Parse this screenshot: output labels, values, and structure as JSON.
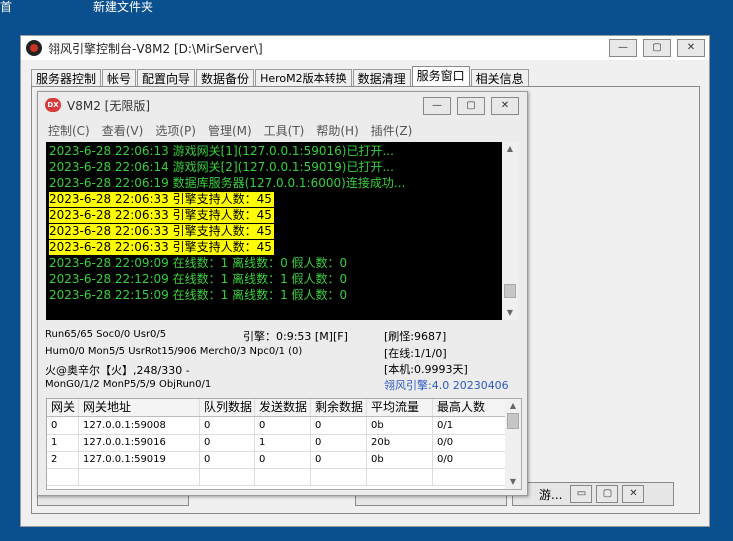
{
  "desktop": {
    "left_label": "首",
    "folder_label": "新建文件夹"
  },
  "outer_window": {
    "title": "翎风引擎控制台-V8M2 [D:\\MirServer\\]",
    "controls": {
      "minimize": "—",
      "maximize": "▢",
      "close": "✕"
    },
    "tabs": [
      "服务器控制",
      "帐号",
      "配置向导",
      "数据备份",
      "HeroM2版本转换",
      "数据清理",
      "服务窗口",
      "相关信息"
    ],
    "active_tab": 6
  },
  "inner_window": {
    "badge": "DX",
    "title": "V8M2 [无限版]",
    "controls": {
      "minimize": "—",
      "maximize": "▢",
      "close": "✕"
    },
    "menu": [
      "控制(C)",
      "查看(V)",
      "选项(P)",
      "管理(M)",
      "工具(T)",
      "帮助(H)",
      "插件(Z)"
    ],
    "log": [
      {
        "text": "2023-6-28 22:06:13 游戏网关[1](127.0.0.1:59016)已打开...",
        "highlight": false
      },
      {
        "text": "2023-6-28 22:06:14 游戏网关[2](127.0.0.1:59019)已打开...",
        "highlight": false
      },
      {
        "text": "2023-6-28 22:06:19 数据库服务器(127.0.0.1:6000)连接成功...",
        "highlight": false
      },
      {
        "text": "2023-6-28 22:06:33 引擎支持人数：45",
        "highlight": true
      },
      {
        "text": "2023-6-28 22:06:33 引擎支持人数：45",
        "highlight": true
      },
      {
        "text": "2023-6-28 22:06:33 引擎支持人数：45",
        "highlight": true
      },
      {
        "text": "2023-6-28 22:06:33 引擎支持人数：45",
        "highlight": true
      },
      {
        "text": "2023-6-28 22:09:09 在线数：1 离线数：0 假人数：0",
        "highlight": false
      },
      {
        "text": "2023-6-28 22:12:09 在线数：1 离线数：1 假人数：0",
        "highlight": false
      },
      {
        "text": "2023-6-28 22:15:09 在线数：1 离线数：1 假人数：0",
        "highlight": false
      }
    ],
    "status": {
      "run": "Run65/65 Soc0/0 Usr0/5",
      "engine": "引擎：0:9:53 [M][F]",
      "refresh": "[刷怪:9687]",
      "hum": "Hum0/0 Mon5/5 UsrRot15/906 Merch0/3 Npc0/1 (0)",
      "online": "[在线:1/1/0]",
      "map": "火@奥辛尔【火】,248/330 -",
      "local": "[本机:0.9993天]",
      "mongo": "MonG0/1/2 MonP5/5/9 ObjRun0/1",
      "version": "翎风引擎:4.0 20230406"
    },
    "gateway_table": {
      "columns": [
        "网关",
        "网关地址",
        "队列数据",
        "发送数据",
        "剩余数据",
        "平均流量",
        "最高人数"
      ],
      "rows": [
        [
          "0",
          "127.0.0.1:59008",
          "0",
          "0",
          "0",
          "0b",
          "0/1"
        ],
        [
          "1",
          "127.0.0.1:59016",
          "0",
          "1",
          "0",
          "20b",
          "0/0"
        ],
        [
          "2",
          "127.0.0.1:59019",
          "0",
          "0",
          "0",
          "0b",
          "0/0"
        ]
      ]
    }
  },
  "background_window": {
    "button_label": "游..."
  },
  "colors": {
    "log_text": "#36d03b",
    "log_highlight": "#ffff00",
    "version_text": "#2b59c3",
    "desktop": "#0a4f8e"
  },
  "icons": [
    "app-logo-icon",
    "dx-badge-icon",
    "scroll-up-icon",
    "scroll-down-icon"
  ]
}
